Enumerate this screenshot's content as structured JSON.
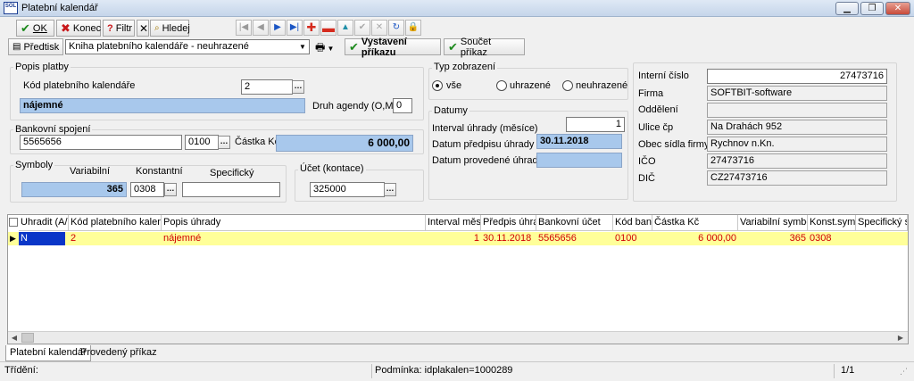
{
  "window": {
    "title": "Platební kalendář",
    "logo_text": "SOL"
  },
  "toolbar1": {
    "ok": "OK",
    "konec": "Konec",
    "filtr": "Filtr",
    "hledej": "Hledej"
  },
  "toolbar2": {
    "predtisk": "Předtisk",
    "report": "Kniha platebního kalendáře - neuhrazené",
    "vystaveni": "Vystavení příkazu",
    "soucet": "Součet příkaz"
  },
  "popis": {
    "title": "Popis platby",
    "kod_label": "Kód platebního kalendáře",
    "kod_value": "2",
    "name_value": "nájemné",
    "druh_label": "Druh agendy (O,M,F)",
    "druh_value": "0"
  },
  "bank": {
    "title": "Bankovní spojení",
    "account": "5565656",
    "bank_code": "0100",
    "castka_label": "Částka Kč",
    "castka_value": "6 000,00"
  },
  "symboly": {
    "title": "Symboly",
    "var_label": "Variabilní",
    "var_value": "365",
    "konst_label": "Konstantní",
    "konst_value": "0308",
    "spec_label": "Specifický",
    "spec_value": ""
  },
  "ucet": {
    "title": "Účet (kontace)",
    "value": "325000"
  },
  "typ": {
    "title": "Typ zobrazení",
    "options": [
      "vše",
      "uhrazené",
      "neuhrazené"
    ],
    "selected": "vše"
  },
  "datumy": {
    "title": "Datumy",
    "interval_label": "Interval úhrady (měsíce)",
    "interval_value": "1",
    "predpis_label": "Datum předpisu úhrady",
    "predpis_value": "30.11.2018",
    "provedeni_label": "Datum provedené úhrady",
    "provedeni_value": ""
  },
  "firma": {
    "ic_label": "Interní číslo",
    "ic_value": "27473716",
    "firma_label": "Firma",
    "firma_value": "SOFTBIT-software",
    "oddeleni_label": "Oddělení",
    "oddeleni_value": "",
    "ulice_label": "Ulice čp",
    "ulice_value": "Na Drahách 952",
    "obec_label": "Obec sídla firmy",
    "obec_value": "Rychnov n.Kn.",
    "ico_label": "IČO",
    "ico_value": "27473716",
    "dic_label": "DIČ",
    "dic_value": "CZ27473716"
  },
  "grid": {
    "columns": [
      "Uhradit (A/N)",
      "Kód platebního kalendáře",
      "Popis úhrady",
      "Interval měsíce",
      "Předpis úhrada",
      "Bankovní účet",
      "Kód banky",
      "Částka Kč",
      "Variabilní symbol",
      "Konst.symbol",
      "Specifický sym"
    ],
    "row": [
      "N",
      "2",
      "nájemné",
      "1",
      "30.11.2018",
      "5565656",
      "0100",
      "6 000,00",
      "365",
      "0308",
      ""
    ]
  },
  "tabs": [
    "Platební kalendář",
    "Provedený příkaz"
  ],
  "status": {
    "trideni": "Třídění:",
    "podminka": "Podmínka: idplakalen=1000289",
    "page": "1/1"
  },
  "colors": {
    "selection_row": "#ffff99",
    "highlight_field": "#a8c8ec",
    "row_text": "#d00000"
  }
}
